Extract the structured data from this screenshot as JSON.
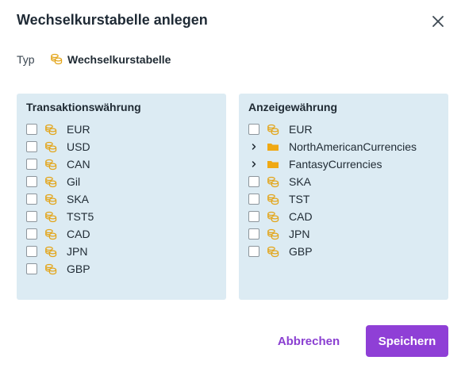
{
  "dialog": {
    "title": "Wechselkurstabelle anlegen",
    "close_icon": "close-icon"
  },
  "type": {
    "label": "Typ",
    "value": "Wechselkurstabelle",
    "icon": "coins-icon"
  },
  "colors": {
    "accent": "#8f3fd6",
    "accent_text": "#8a3fd1",
    "panel_bg": "#dcebf3",
    "icon_gold": "#e3a51a"
  },
  "transaction_panel": {
    "title": "Transaktionswährung",
    "items": [
      {
        "label": "EUR",
        "icon": "coins-icon",
        "checked": false
      },
      {
        "label": "USD",
        "icon": "coins-icon",
        "checked": false
      },
      {
        "label": "CAN",
        "icon": "coins-icon",
        "checked": false
      },
      {
        "label": "Gil",
        "icon": "coins-icon",
        "checked": false
      },
      {
        "label": "SKA",
        "icon": "coins-icon",
        "checked": false
      },
      {
        "label": "TST5",
        "icon": "coins-icon",
        "checked": false
      },
      {
        "label": "CAD",
        "icon": "coins-icon",
        "checked": false
      },
      {
        "label": "JPN",
        "icon": "coins-icon",
        "checked": false
      },
      {
        "label": "GBP",
        "icon": "coins-icon",
        "checked": false
      }
    ]
  },
  "display_panel": {
    "title": "Anzeigewährung",
    "items": [
      {
        "label": "EUR",
        "icon": "coins-icon",
        "kind": "currency",
        "checked": false
      },
      {
        "label": "NorthAmericanCurrencies",
        "icon": "folder-icon",
        "kind": "folder",
        "expanded": false
      },
      {
        "label": "FantasyCurrencies",
        "icon": "folder-icon",
        "kind": "folder",
        "expanded": false
      },
      {
        "label": "SKA",
        "icon": "coins-icon",
        "kind": "currency",
        "checked": false
      },
      {
        "label": "TST",
        "icon": "coins-icon",
        "kind": "currency",
        "checked": false
      },
      {
        "label": "CAD",
        "icon": "coins-icon",
        "kind": "currency",
        "checked": false
      },
      {
        "label": "JPN",
        "icon": "coins-icon",
        "kind": "currency",
        "checked": false
      },
      {
        "label": "GBP",
        "icon": "coins-icon",
        "kind": "currency",
        "checked": false
      }
    ]
  },
  "footer": {
    "cancel_label": "Abbrechen",
    "save_label": "Speichern"
  }
}
